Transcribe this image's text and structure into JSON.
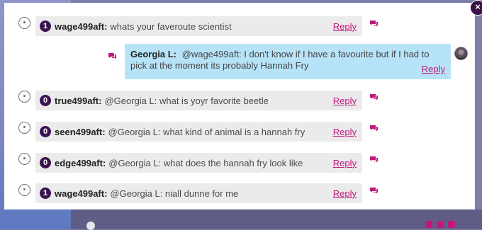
{
  "close_label": "×",
  "reply_label": "Reply",
  "accent_color": "#c0187b",
  "top_message": {
    "count": "1",
    "user": "wage499aft:",
    "text": "whats your faveroute scientist"
  },
  "my_reply": {
    "user": "Georgia L:",
    "text": "@wage499aft: I don't know if I have a favourite but if I had to pick at the moment its probably Hannah Fry"
  },
  "messages": [
    {
      "count": "0",
      "user": "true499aft:",
      "text": "@Georgia L: what is yoyr favorite beetle"
    },
    {
      "count": "0",
      "user": "seen499aft:",
      "text": "@Georgia L: what kind of animal is a hannah fry"
    },
    {
      "count": "0",
      "user": "edge499aft:",
      "text": "@Georgia L: what does the hannah fry look like"
    },
    {
      "count": "1",
      "user": "wage499aft:",
      "text": "@Georgia L: niall dunne for me"
    }
  ]
}
